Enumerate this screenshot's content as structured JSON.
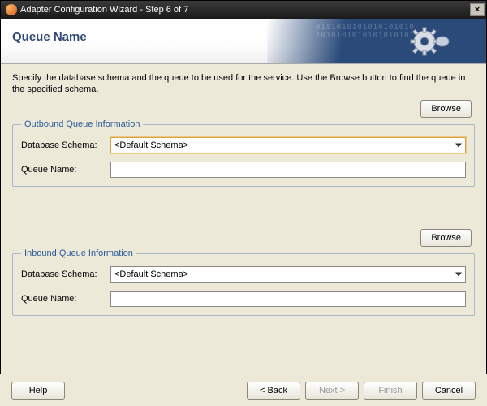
{
  "window": {
    "title": "Adapter Configuration Wizard - Step 6 of 7",
    "close_label": "×"
  },
  "header": {
    "title": "Queue Name",
    "binary_bg": "0101010101010101010\n1010101010101010101"
  },
  "instructions": "Specify the database schema and the queue to be used for the service. Use the Browse button to find the queue in the specified schema.",
  "outbound": {
    "legend": "Outbound Queue Information",
    "browse_label": "Browse",
    "schema_label_pre": "Database ",
    "schema_label_u": "S",
    "schema_label_post": "chema:",
    "schema_value": "<Default Schema>",
    "queue_label": "Queue Name:",
    "queue_value": ""
  },
  "inbound": {
    "legend": "Inbound Queue Information",
    "browse_label": "Browse",
    "schema_label": "Database Schema:",
    "schema_value": "<Default Schema>",
    "queue_label": "Queue Name:",
    "queue_value": ""
  },
  "footer": {
    "help": "Help",
    "back": "< Back",
    "next": "Next >",
    "finish": "Finish",
    "cancel": "Cancel"
  }
}
